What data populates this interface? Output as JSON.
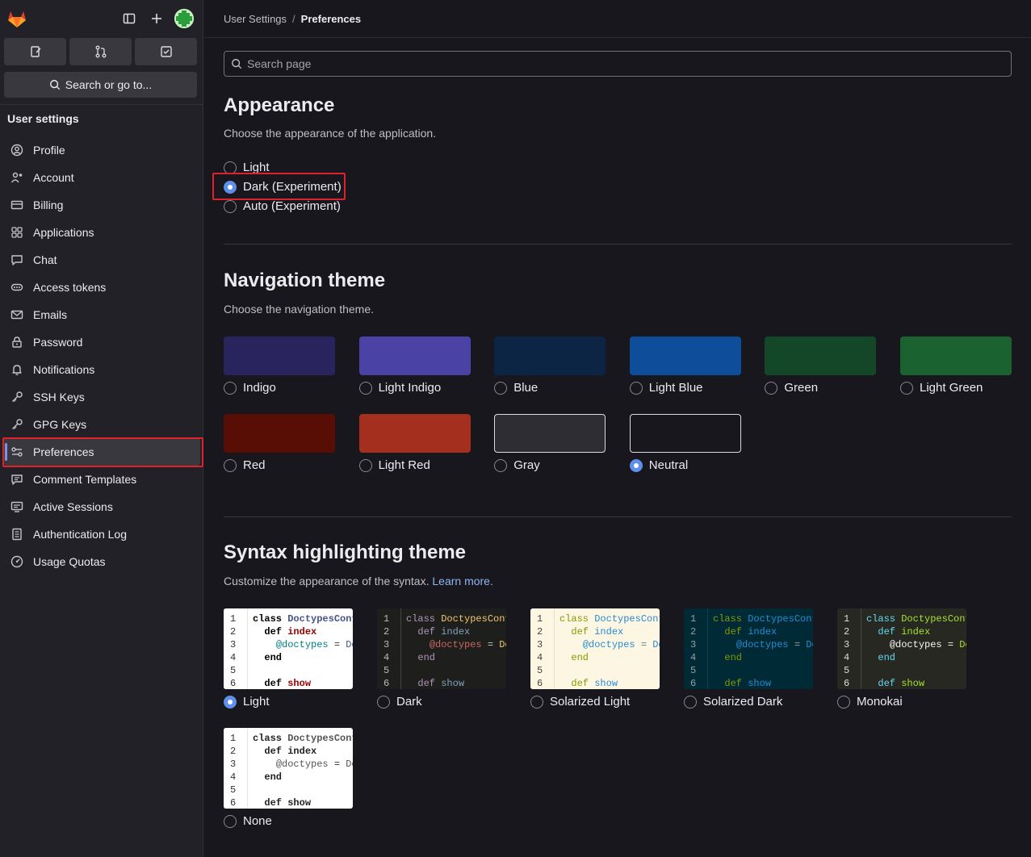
{
  "sidebar": {
    "search_label": "Search or go to...",
    "section_title": "User settings",
    "items": [
      {
        "label": "Profile",
        "icon": "profile-icon"
      },
      {
        "label": "Account",
        "icon": "account-icon"
      },
      {
        "label": "Billing",
        "icon": "billing-icon"
      },
      {
        "label": "Applications",
        "icon": "applications-icon"
      },
      {
        "label": "Chat",
        "icon": "chat-icon"
      },
      {
        "label": "Access tokens",
        "icon": "token-icon"
      },
      {
        "label": "Emails",
        "icon": "mail-icon"
      },
      {
        "label": "Password",
        "icon": "lock-icon"
      },
      {
        "label": "Notifications",
        "icon": "bell-icon"
      },
      {
        "label": "SSH Keys",
        "icon": "key-icon"
      },
      {
        "label": "GPG Keys",
        "icon": "key-icon"
      },
      {
        "label": "Preferences",
        "icon": "preferences-icon",
        "active": true
      },
      {
        "label": "Comment Templates",
        "icon": "comment-icon"
      },
      {
        "label": "Active Sessions",
        "icon": "monitor-icon"
      },
      {
        "label": "Authentication Log",
        "icon": "log-icon"
      },
      {
        "label": "Usage Quotas",
        "icon": "gauge-icon"
      }
    ]
  },
  "breadcrumb": {
    "parent": "User Settings",
    "separator": "/",
    "current": "Preferences"
  },
  "search": {
    "placeholder": "Search page"
  },
  "appearance": {
    "title": "Appearance",
    "description": "Choose the appearance of the application.",
    "options": [
      {
        "label": "Light",
        "selected": false
      },
      {
        "label": "Dark (Experiment)",
        "selected": true
      },
      {
        "label": "Auto (Experiment)",
        "selected": false
      }
    ]
  },
  "navigation": {
    "title": "Navigation theme",
    "description": "Choose the navigation theme.",
    "themes": [
      {
        "label": "Indigo",
        "color": "#29245e",
        "selected": false
      },
      {
        "label": "Light Indigo",
        "color": "#4a43a5",
        "selected": false
      },
      {
        "label": "Blue",
        "color": "#0c2545",
        "selected": false
      },
      {
        "label": "Light Blue",
        "color": "#0e4d99",
        "selected": false
      },
      {
        "label": "Green",
        "color": "#134728",
        "selected": false
      },
      {
        "label": "Light Green",
        "color": "#1b6231",
        "selected": false
      },
      {
        "label": "Red",
        "color": "#580e04",
        "selected": false
      },
      {
        "label": "Light Red",
        "color": "#a42f1e",
        "selected": false
      },
      {
        "label": "Gray",
        "color": "#2e2d33",
        "selected": false
      },
      {
        "label": "Neutral",
        "color": "#18171d",
        "selected": true
      }
    ]
  },
  "syntax": {
    "title": "Syntax highlighting theme",
    "description": "Customize the appearance of the syntax.",
    "learn_more": "Learn more.",
    "code_lines": [
      "class DoctypesCont",
      "  def index",
      "    @doctypes = Do",
      "  end",
      "",
      "  def show"
    ],
    "line_numbers": [
      "1",
      "2",
      "3",
      "4",
      "5",
      "6"
    ],
    "themes": [
      {
        "label": "Light",
        "selected": true
      },
      {
        "label": "Dark",
        "selected": false
      },
      {
        "label": "Solarized Light",
        "selected": false
      },
      {
        "label": "Solarized Dark",
        "selected": false
      },
      {
        "label": "Monokai",
        "selected": false
      },
      {
        "label": "None",
        "selected": false
      }
    ]
  }
}
